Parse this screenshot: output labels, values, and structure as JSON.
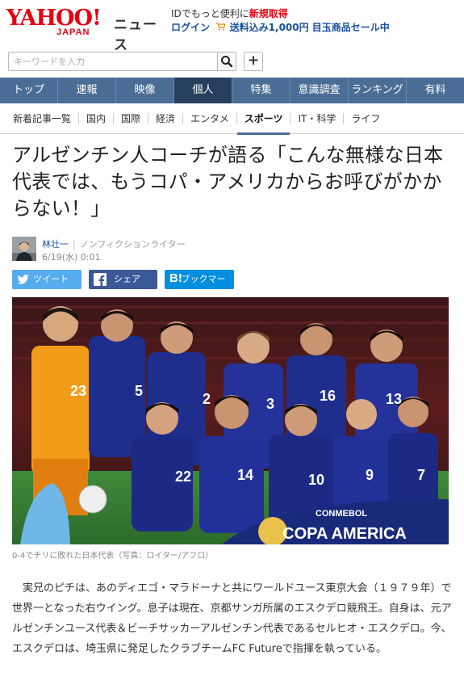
{
  "header": {
    "logo_main": "YAHOO!",
    "logo_sub": "JAPAN",
    "logo_section": "ニュース",
    "info_line1_prefix": "IDでもっと便利に",
    "info_line1_link": "新規取得",
    "info_login": "ログイン",
    "cart_icon": "cart-icon",
    "info_promo": "送料込み1,000円 目玉商品セール中"
  },
  "search": {
    "placeholder": "キーワードを入力",
    "value": ""
  },
  "main_nav": [
    {
      "label": "トップ",
      "active": false
    },
    {
      "label": "速報",
      "active": false
    },
    {
      "label": "映像",
      "active": false
    },
    {
      "label": "個人",
      "active": true
    },
    {
      "label": "特集",
      "active": false
    },
    {
      "label": "意識調査",
      "active": false
    },
    {
      "label": "ランキング",
      "active": false
    },
    {
      "label": "有料",
      "active": false
    }
  ],
  "sub_nav": [
    {
      "label": "新着記事一覧",
      "active": false
    },
    {
      "label": "国内",
      "active": false
    },
    {
      "label": "国際",
      "active": false
    },
    {
      "label": "経済",
      "active": false
    },
    {
      "label": "エンタメ",
      "active": false
    },
    {
      "label": "スポーツ",
      "active": true
    },
    {
      "label": "IT・科学",
      "active": false
    },
    {
      "label": "ライフ",
      "active": false
    }
  ],
  "article": {
    "title": "アルゼンチン人コーチが語る「こんな無様な日本代表では、もうコパ・アメリカからお呼びがかからない！」",
    "author_name": "林壮一",
    "author_role": "ノンフィクションライター",
    "date": "6/19(水) 0:01",
    "share": {
      "twitter": "ツイート",
      "facebook": "シェア",
      "hatena": "ブックマー",
      "hatena_mark": "B!"
    },
    "photo_jerseys": [
      "23",
      "5",
      "2",
      "3",
      "16",
      "13",
      "22",
      "14",
      "10",
      "9",
      "7"
    ],
    "photo_banner_top": "CONMEBOL",
    "photo_banner_main": "COPA AMERICA",
    "caption": "0-4でチリに敗れた日本代表（写真：ロイター/アフロ）",
    "body": "実兄のピチは、あのディエゴ・マラドーナと共にワールドユース東京大会（１９７９年）で世界一となった右ウイング。息子は現在、京都サンガ所属のエスクデロ競飛王。自身は、元アルゼンチンユース代表＆ビーチサッカーアルゼンチン代表であるセルヒオ・エスクデロ。今、エスクデロは、埼玉県に発足したクラブチームFC Futureで指揮を執っている。"
  },
  "colors": {
    "brand_red": "#e60012",
    "nav_blue": "#4a6d95",
    "nav_active": "#263f5e",
    "twitter": "#55acee",
    "facebook": "#3b5998",
    "hatena": "#008fde"
  }
}
